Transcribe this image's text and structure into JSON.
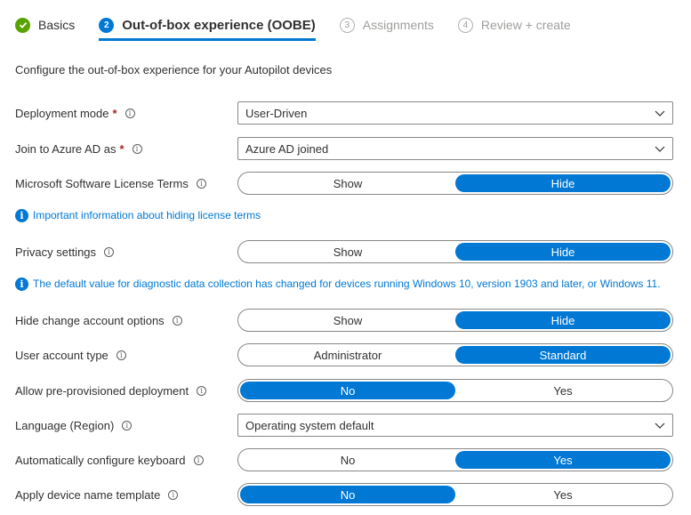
{
  "steps": [
    {
      "number": "",
      "label": "Basics",
      "state": "done"
    },
    {
      "number": "2",
      "label": "Out-of-box experience (OOBE)",
      "state": "active"
    },
    {
      "number": "3",
      "label": "Assignments",
      "state": "pending"
    },
    {
      "number": "4",
      "label": "Review + create",
      "state": "pending"
    }
  ],
  "intro": "Configure the out-of-box experience for your Autopilot devices",
  "fields": {
    "deployment_mode": {
      "label": "Deployment mode",
      "required": "*",
      "value": "User-Driven"
    },
    "join_azure": {
      "label": "Join to Azure AD as",
      "required": "*",
      "value": "Azure AD joined"
    },
    "license_terms": {
      "label": "Microsoft Software License Terms",
      "options": [
        "Show",
        "Hide"
      ],
      "selected": "Hide"
    },
    "privacy": {
      "label": "Privacy settings",
      "options": [
        "Show",
        "Hide"
      ],
      "selected": "Hide"
    },
    "change_account": {
      "label": "Hide change account options",
      "options": [
        "Show",
        "Hide"
      ],
      "selected": "Hide"
    },
    "account_type": {
      "label": "User account type",
      "options": [
        "Administrator",
        "Standard"
      ],
      "selected": "Standard"
    },
    "preprovisioned": {
      "label": "Allow pre-provisioned deployment",
      "options": [
        "No",
        "Yes"
      ],
      "selected": "No"
    },
    "language": {
      "label": "Language (Region)",
      "value": "Operating system default"
    },
    "keyboard": {
      "label": "Automatically configure keyboard",
      "options": [
        "No",
        "Yes"
      ],
      "selected": "Yes"
    },
    "device_name": {
      "label": "Apply device name template",
      "options": [
        "No",
        "Yes"
      ],
      "selected": "No"
    }
  },
  "notes": {
    "license": "Important information about hiding license terms",
    "privacy": "The default value for diagnostic data collection has changed for devices running Windows 10, version 1903 and later, or Windows 11."
  },
  "colors": {
    "accent": "#0078d4",
    "done": "#57a300",
    "required": "#a4262c"
  }
}
